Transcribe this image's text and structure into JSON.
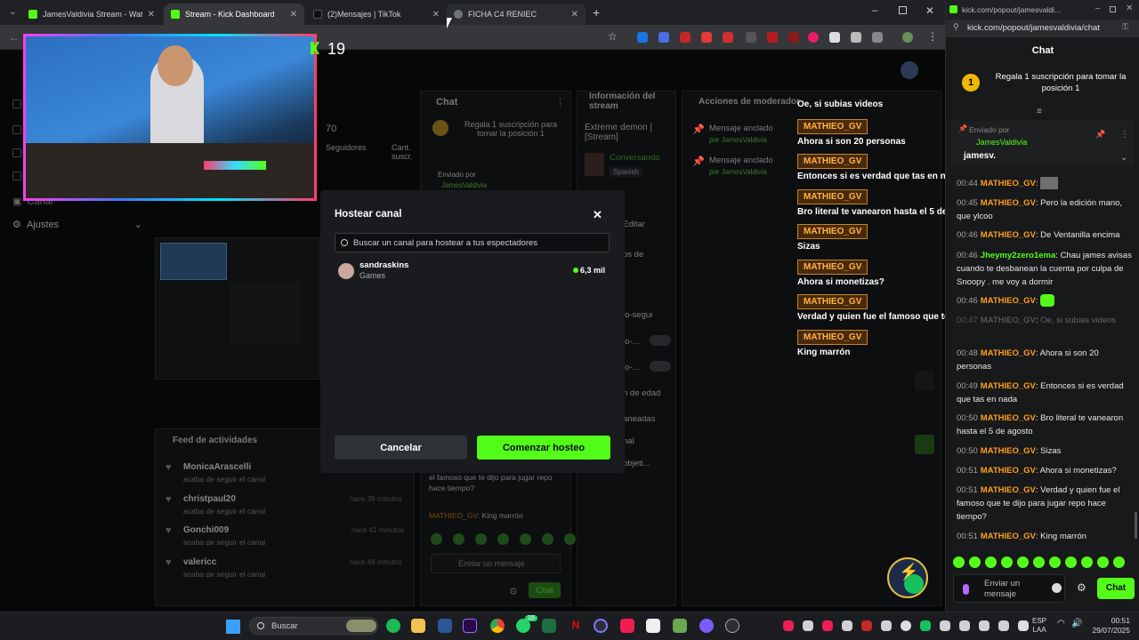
{
  "tabs": [
    {
      "label": "JamesValdivia Stream - Watch L",
      "color": "#53fc18"
    },
    {
      "label": "Stream - Kick Dashboard",
      "color": "#53fc18"
    },
    {
      "label": "(2)Mensajes | TikTok",
      "color": "#111111"
    },
    {
      "label": "FICHA C4 RENIEC",
      "color": "#9aa0a6"
    }
  ],
  "viewer_count": "19",
  "dashboard": {
    "chat_header": "Chat",
    "stream_info_header": "Información del stream",
    "mod_actions_header": "Acciones de moderador",
    "followers_count": "70",
    "followers_label": "Seguidores",
    "cant_label": "Cant. suscr.",
    "gift_sub_promo": "Regala 1 suscripción para tomar la posición 1",
    "sent_by": "Enviado por",
    "sent_by_user": "JamesValdivia",
    "stream_title": "Extreme demon | [Stream]",
    "category_status": "Conversando",
    "language": "Spanish",
    "pinned_msg_1": "Mensaje anclado",
    "pinned_by_1": "por JamesValdivia",
    "pinned_msg_2": "Mensaje anclado",
    "pinned_by_2": "por JamesValdivia",
    "sidebar_canal": "Canal",
    "sidebar_ajustes": "Ajustes",
    "activity_header": "Feed de actividades",
    "activity": [
      {
        "user": "MonicaArascelli",
        "action": "acaba de seguir el canal",
        "time": ""
      },
      {
        "user": "christpaul20",
        "action": "acaba de seguir el canal",
        "time": "hace 39 minutos"
      },
      {
        "user": "Gonchi009",
        "action": "acaba de seguir el canal",
        "time": "hace 41 minutos"
      },
      {
        "user": "valericc",
        "action": "acaba de seguir el canal",
        "time": "hace 48 minutos"
      }
    ],
    "inner_chat_msg1": "el famoso que te dijo para jugar repo hace tiempo?",
    "inner_chat_msg2_user": "MATHIEO_GV",
    "inner_chat_msg2": "King marrón",
    "inner_chat_input": "Enviar un mensaje",
    "inner_chat_button": "Chat",
    "right_side_items": [
      "Editar",
      "os de",
      "lo-segui",
      "lo-...",
      "lo-...",
      "n de edad",
      "aneadas",
      "nal",
      "objeti..."
    ]
  },
  "overlay_chat": [
    {
      "user": "",
      "msg": "Oe, si subias videos"
    },
    {
      "user": "MATHIEO_GV",
      "msg": "Ahora si son 20 personas"
    },
    {
      "user": "MATHIEO_GV",
      "msg": "Entonces si es verdad que tas en nada"
    },
    {
      "user": "MATHIEO_GV",
      "msg": "Bro literal te vanearon hasta el 5 de agosto"
    },
    {
      "user": "MATHIEO_GV",
      "msg": "Sizas"
    },
    {
      "user": "MATHIEO_GV",
      "msg": "Ahora si monetizas?"
    },
    {
      "user": "MATHIEO_GV",
      "msg": "Verdad y quien fue el famoso que te dijo para jugar repo hace tiempo?"
    },
    {
      "user": "MATHIEO_GV",
      "msg": "King marrón"
    }
  ],
  "modal": {
    "title": "Hostear canal",
    "search_placeholder": "Buscar un canal para hostear a tus espectadores",
    "result_name": "sandraskins",
    "result_category": "Games",
    "result_viewers": "6,3 mil",
    "cancel_label": "Cancelar",
    "start_label": "Comenzar hosteo",
    "accent": "#53fc18"
  },
  "popout": {
    "url": "kick.com/popout/jamesvaldi...",
    "url2": "kick.com/popout/jamesvaldivia/chat",
    "title": "Chat",
    "gift_promo": "Regala 1 suscripción para tomar la posición 1",
    "pinned_sent_by": "Enviado por",
    "pinned_user": "JamesValdivia",
    "pinned_text": "jamesv.",
    "messages": [
      {
        "time": "00:44",
        "user": "MATHIEO_GV",
        "text": ""
      },
      {
        "time": "00:45",
        "user": "MATHIEO_GV",
        "text": "Pero la edición mano, que ylcoo"
      },
      {
        "time": "00:46",
        "user": "MATHIEO_GV",
        "text": "De Ventanilla encima"
      },
      {
        "time": "00:46",
        "user": "Jheymy2zero1ema",
        "text": "Chau james avisas cuando te desbanean la cuenta por culpa de Snoopy . me voy a dormir"
      },
      {
        "time": "00:46",
        "user": "MATHIEO_GV",
        "text": ""
      },
      {
        "time": "00:47",
        "user": "MATHIEO_GV",
        "text": "Oe, si subias videos"
      },
      {
        "time": "00:48",
        "user": "MATHIEO_GV",
        "text": "Ahora si son 20 personas"
      },
      {
        "time": "00:49",
        "user": "MATHIEO_GV",
        "text": "Entonces si es verdad que tas en nada"
      },
      {
        "time": "00:50",
        "user": "MATHIEO_GV",
        "text": "Bro literal te vanearon hasta el 5 de agosto"
      },
      {
        "time": "00:50",
        "user": "MATHIEO_GV",
        "text": "Sizas"
      },
      {
        "time": "00:51",
        "user": "MATHIEO_GV",
        "text": "Ahora si monetizas?"
      },
      {
        "time": "00:51",
        "user": "MATHIEO_GV",
        "text": "Verdad y quien fue el famoso que te dijo para jugar repo hace tiempo?"
      },
      {
        "time": "00:51",
        "user": "MATHIEO_GV",
        "text": "King marrón"
      }
    ],
    "input_placeholder": "Enviar un mensaje",
    "chat_button": "Chat"
  },
  "taskbar": {
    "search_placeholder": "Buscar",
    "lang_line1": "ESP",
    "lang_line2": "LAA",
    "time": "00:51",
    "date": "29/07/2025",
    "badge_count": "15"
  }
}
